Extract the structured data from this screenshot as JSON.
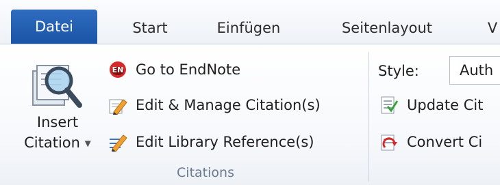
{
  "tabs": [
    {
      "label": "Datei",
      "active": true
    },
    {
      "label": "Start"
    },
    {
      "label": "Einfügen"
    },
    {
      "label": "Seitenlayout"
    },
    {
      "label": "V"
    }
  ],
  "citations_group": {
    "insert_citation": {
      "line1": "Insert",
      "line2": "Citation",
      "icon": "insert-citation-magnifier-icon"
    },
    "buttons": [
      {
        "label": "Go to EndNote",
        "icon": "endnote-logo-icon"
      },
      {
        "label": "Edit & Manage Citation(s)",
        "icon": "edit-citation-pencil-icon"
      },
      {
        "label": "Edit Library Reference(s)",
        "icon": "edit-library-reference-icon"
      }
    ],
    "group_label": "Citations"
  },
  "bibliography_group": {
    "style_label": "Style:",
    "style_value": "Auth",
    "buttons": [
      {
        "label": "Update Cit",
        "icon": "update-citations-icon"
      },
      {
        "label": "Convert Ci",
        "icon": "convert-citations-icon"
      }
    ]
  },
  "colors": {
    "file_tab": "#1f5bb0",
    "group_label": "#6b7b8f"
  }
}
